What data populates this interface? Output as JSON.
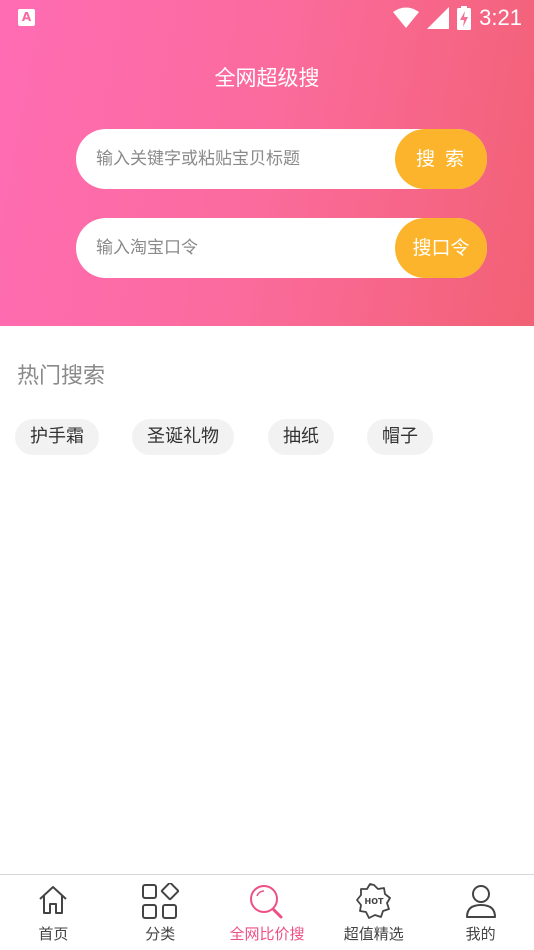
{
  "status_bar": {
    "app_badge": "A",
    "time": "3:21"
  },
  "header": {
    "title": "全网超级搜"
  },
  "keyword_search": {
    "placeholder": "输入关键字或粘贴宝贝标题",
    "button_label": "搜 索"
  },
  "code_search": {
    "placeholder": "输入淘宝口令",
    "button_label": "搜口令"
  },
  "hot_search": {
    "title": "热门搜索",
    "tags": [
      "护手霜",
      "圣诞礼物",
      "抽纸",
      "帽子"
    ]
  },
  "tabbar": {
    "items": [
      {
        "label": "首页",
        "icon": "home-icon"
      },
      {
        "label": "分类",
        "icon": "category-icon"
      },
      {
        "label": "全网比价搜",
        "icon": "search-icon"
      },
      {
        "label": "超值精选",
        "icon": "hot-badge-icon"
      },
      {
        "label": "我的",
        "icon": "user-icon"
      }
    ],
    "active": "全网比价搜"
  },
  "colors": {
    "accent_pink": "#ee4f86",
    "button_orange": "#fbb42b",
    "gradient_start": "#ff6cb4",
    "gradient_end": "#f26174"
  }
}
